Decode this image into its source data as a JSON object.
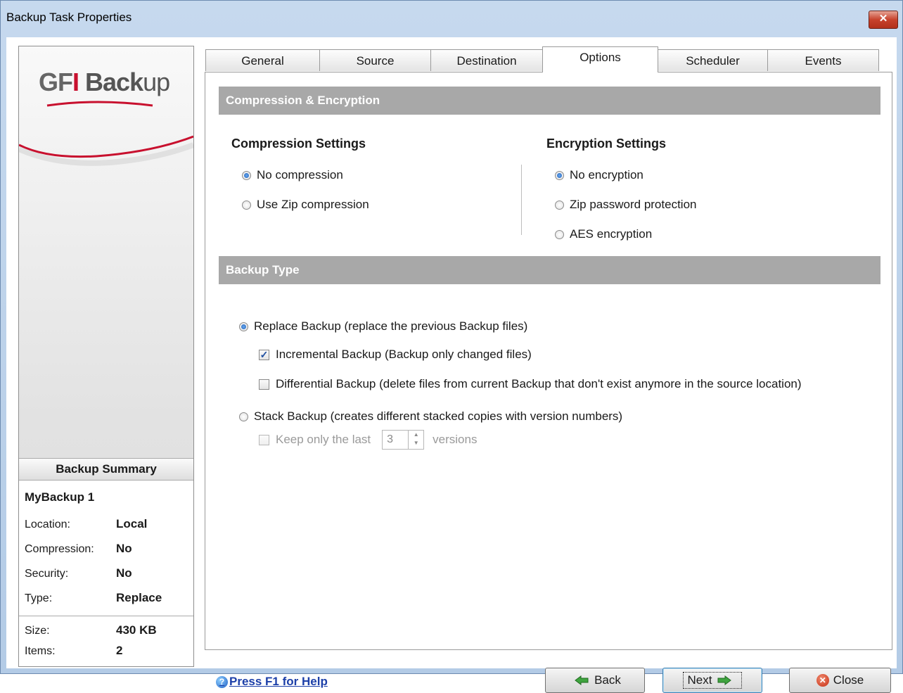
{
  "window": {
    "title": "Backup Task Properties",
    "close_glyph": "✕"
  },
  "logo": {
    "gfi": "GF",
    "i": "I",
    "back": "Back",
    "up": "up"
  },
  "summary": {
    "heading": "Backup Summary",
    "name": "MyBackup 1",
    "rows": [
      {
        "label": "Location:",
        "value": "Local"
      },
      {
        "label": "Compression:",
        "value": "No"
      },
      {
        "label": "Security:",
        "value": "No"
      },
      {
        "label": "Type:",
        "value": "Replace"
      },
      {
        "label": "Size:",
        "value": "430 KB"
      },
      {
        "label": "Items:",
        "value": "2"
      }
    ]
  },
  "tabs": [
    {
      "label": "General",
      "active": false
    },
    {
      "label": "Source",
      "active": false
    },
    {
      "label": "Destination",
      "active": false
    },
    {
      "label": "Options",
      "active": true
    },
    {
      "label": "Scheduler",
      "active": false
    },
    {
      "label": "Events",
      "active": false
    }
  ],
  "options": {
    "section1": "Compression & Encryption",
    "compression": {
      "heading": "Compression Settings",
      "choices": [
        "No compression",
        "Use Zip compression"
      ],
      "selected": "No compression"
    },
    "encryption": {
      "heading": "Encryption Settings",
      "choices": [
        "No encryption",
        "Zip password protection",
        "AES encryption"
      ],
      "selected": "No encryption"
    },
    "section2": "Backup Type",
    "replace": {
      "label": "Replace Backup (replace the previous Backup files)",
      "selected": true
    },
    "incremental": {
      "label": "Incremental Backup (Backup only changed files)",
      "checked": true
    },
    "differential": {
      "label": "Differential Backup (delete files from current Backup that don't exist anymore in the source location)",
      "checked": false
    },
    "stack": {
      "label": "Stack Backup (creates different stacked copies with version numbers)",
      "selected": false
    },
    "keep": {
      "label": "Keep only the last",
      "value": "3",
      "suffix": "versions",
      "checked": false,
      "enabled": false
    }
  },
  "footer": {
    "help": "Press F1 for Help",
    "back": "Back",
    "next": "Next",
    "close": "Close"
  },
  "icons": {
    "help": "help-globe-icon",
    "back": "green-arrow-left-icon",
    "next": "green-arrow-right-icon",
    "close": "red-x-circle-icon"
  },
  "colors": {
    "section_header": "#a8a8a8",
    "link": "#1c3fa8",
    "logo_red": "#c8102e",
    "arrow_green": "#3fa43f"
  }
}
